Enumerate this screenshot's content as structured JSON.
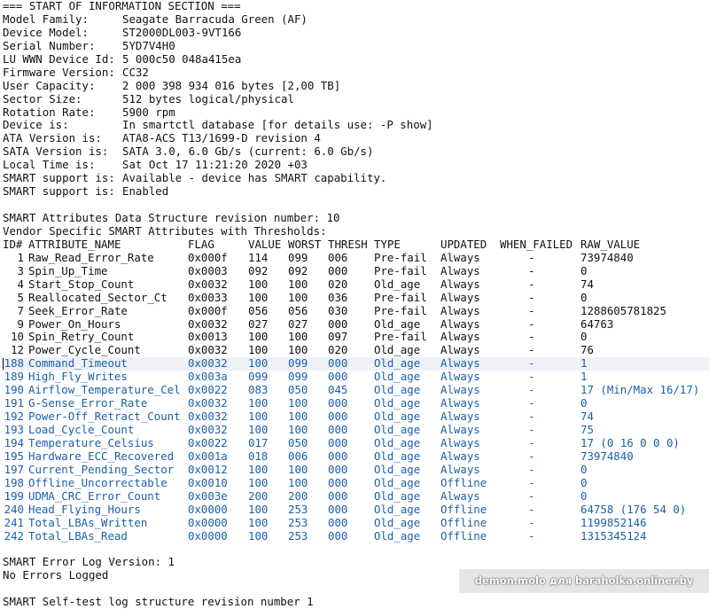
{
  "header_line": "=== START OF INFORMATION SECTION ===",
  "info": [
    {
      "key": "Model Family:",
      "value": "Seagate Barracuda Green (AF)"
    },
    {
      "key": "Device Model:",
      "value": "ST2000DL003-9VT166"
    },
    {
      "key": "Serial Number:",
      "value": "5YD7V4H0"
    },
    {
      "key": "LU WWN Device Id:",
      "value": "5 000c50 048a415ea"
    },
    {
      "key": "Firmware Version:",
      "value": "CC32"
    },
    {
      "key": "User Capacity:",
      "value": "2 000 398 934 016 bytes [2,00 TB]"
    },
    {
      "key": "Sector Size:",
      "value": "512 bytes logical/physical"
    },
    {
      "key": "Rotation Rate:",
      "value": "5900 rpm"
    },
    {
      "key": "Device is:",
      "value": "In smartctl database [for details use: -P show]"
    },
    {
      "key": "ATA Version is:",
      "value": "ATA8-ACS T13/1699-D revision 4"
    },
    {
      "key": "SATA Version is:",
      "value": "SATA 3.0, 6.0 Gb/s (current: 6.0 Gb/s)"
    },
    {
      "key": "Local Time is:",
      "value": "Sat Oct 17 11:21:20 2020 +03"
    },
    {
      "key": "SMART support is:",
      "value": "Available - device has SMART capability."
    },
    {
      "key": "SMART support is:",
      "value": "Enabled"
    }
  ],
  "revision_line": "SMART Attributes Data Structure revision number: 10",
  "vendor_line": "Vendor Specific SMART Attributes with Thresholds:",
  "columns": [
    "ID#",
    "ATTRIBUTE_NAME",
    "FLAG",
    "VALUE",
    "WORST",
    "THRESH",
    "TYPE",
    "UPDATED",
    "WHEN_FAILED",
    "RAW_VALUE"
  ],
  "attributes": [
    {
      "id": "1",
      "name": "Raw_Read_Error_Rate",
      "flag": "0x000f",
      "value": "114",
      "worst": "099",
      "thresh": "006",
      "type": "Pre-fail",
      "updated": "Always",
      "when_failed": "-",
      "raw": "73974840",
      "blue": false
    },
    {
      "id": "3",
      "name": "Spin_Up_Time",
      "flag": "0x0003",
      "value": "092",
      "worst": "092",
      "thresh": "000",
      "type": "Pre-fail",
      "updated": "Always",
      "when_failed": "-",
      "raw": "0",
      "blue": false
    },
    {
      "id": "4",
      "name": "Start_Stop_Count",
      "flag": "0x0032",
      "value": "100",
      "worst": "100",
      "thresh": "020",
      "type": "Old_age",
      "updated": "Always",
      "when_failed": "-",
      "raw": "74",
      "blue": false
    },
    {
      "id": "5",
      "name": "Reallocated_Sector_Ct",
      "flag": "0x0033",
      "value": "100",
      "worst": "100",
      "thresh": "036",
      "type": "Pre-fail",
      "updated": "Always",
      "when_failed": "-",
      "raw": "0",
      "blue": false
    },
    {
      "id": "7",
      "name": "Seek_Error_Rate",
      "flag": "0x000f",
      "value": "056",
      "worst": "056",
      "thresh": "030",
      "type": "Pre-fail",
      "updated": "Always",
      "when_failed": "-",
      "raw": "1288605781825",
      "blue": false
    },
    {
      "id": "9",
      "name": "Power_On_Hours",
      "flag": "0x0032",
      "value": "027",
      "worst": "027",
      "thresh": "000",
      "type": "Old_age",
      "updated": "Always",
      "when_failed": "-",
      "raw": "64763",
      "blue": false
    },
    {
      "id": "10",
      "name": "Spin_Retry_Count",
      "flag": "0x0013",
      "value": "100",
      "worst": "100",
      "thresh": "097",
      "type": "Pre-fail",
      "updated": "Always",
      "when_failed": "-",
      "raw": "0",
      "blue": false
    },
    {
      "id": "12",
      "name": "Power_Cycle_Count",
      "flag": "0x0032",
      "value": "100",
      "worst": "100",
      "thresh": "020",
      "type": "Old_age",
      "updated": "Always",
      "when_failed": "-",
      "raw": "76",
      "blue": false
    },
    {
      "id": "188",
      "name": "Command_Timeout",
      "flag": "0x0032",
      "value": "100",
      "worst": "099",
      "thresh": "000",
      "type": "Old_age",
      "updated": "Always",
      "when_failed": "-",
      "raw": "1",
      "blue": true,
      "selected": true
    },
    {
      "id": "189",
      "name": "High_Fly_Writes",
      "flag": "0x003a",
      "value": "099",
      "worst": "099",
      "thresh": "000",
      "type": "Old_age",
      "updated": "Always",
      "when_failed": "-",
      "raw": "1",
      "blue": true
    },
    {
      "id": "190",
      "name": "Airflow_Temperature_Cel",
      "flag": "0x0022",
      "value": "083",
      "worst": "050",
      "thresh": "045",
      "type": "Old_age",
      "updated": "Always",
      "when_failed": "-",
      "raw": "17 (Min/Max 16/17)",
      "blue": true
    },
    {
      "id": "191",
      "name": "G-Sense_Error_Rate",
      "flag": "0x0032",
      "value": "100",
      "worst": "100",
      "thresh": "000",
      "type": "Old_age",
      "updated": "Always",
      "when_failed": "-",
      "raw": "0",
      "blue": true
    },
    {
      "id": "192",
      "name": "Power-Off_Retract_Count",
      "flag": "0x0032",
      "value": "100",
      "worst": "100",
      "thresh": "000",
      "type": "Old_age",
      "updated": "Always",
      "when_failed": "-",
      "raw": "74",
      "blue": true
    },
    {
      "id": "193",
      "name": "Load_Cycle_Count",
      "flag": "0x0032",
      "value": "100",
      "worst": "100",
      "thresh": "000",
      "type": "Old_age",
      "updated": "Always",
      "when_failed": "-",
      "raw": "75",
      "blue": true
    },
    {
      "id": "194",
      "name": "Temperature_Celsius",
      "flag": "0x0022",
      "value": "017",
      "worst": "050",
      "thresh": "000",
      "type": "Old_age",
      "updated": "Always",
      "when_failed": "-",
      "raw": "17 (0 16 0 0 0)",
      "blue": true
    },
    {
      "id": "195",
      "name": "Hardware_ECC_Recovered",
      "flag": "0x001a",
      "value": "018",
      "worst": "006",
      "thresh": "000",
      "type": "Old_age",
      "updated": "Always",
      "when_failed": "-",
      "raw": "73974840",
      "blue": true
    },
    {
      "id": "197",
      "name": "Current_Pending_Sector",
      "flag": "0x0012",
      "value": "100",
      "worst": "100",
      "thresh": "000",
      "type": "Old_age",
      "updated": "Always",
      "when_failed": "-",
      "raw": "0",
      "blue": true
    },
    {
      "id": "198",
      "name": "Offline_Uncorrectable",
      "flag": "0x0010",
      "value": "100",
      "worst": "100",
      "thresh": "000",
      "type": "Old_age",
      "updated": "Offline",
      "when_failed": "-",
      "raw": "0",
      "blue": true
    },
    {
      "id": "199",
      "name": "UDMA_CRC_Error_Count",
      "flag": "0x003e",
      "value": "200",
      "worst": "200",
      "thresh": "000",
      "type": "Old_age",
      "updated": "Always",
      "when_failed": "-",
      "raw": "0",
      "blue": true
    },
    {
      "id": "240",
      "name": "Head_Flying_Hours",
      "flag": "0x0000",
      "value": "100",
      "worst": "253",
      "thresh": "000",
      "type": "Old_age",
      "updated": "Offline",
      "when_failed": "-",
      "raw": "64758 (176 54 0)",
      "blue": true
    },
    {
      "id": "241",
      "name": "Total_LBAs_Written",
      "flag": "0x0000",
      "value": "100",
      "worst": "253",
      "thresh": "000",
      "type": "Old_age",
      "updated": "Offline",
      "when_failed": "-",
      "raw": "1199852146",
      "blue": true
    },
    {
      "id": "242",
      "name": "Total_LBAs_Read",
      "flag": "0x0000",
      "value": "100",
      "worst": "253",
      "thresh": "000",
      "type": "Old_age",
      "updated": "Offline",
      "when_failed": "-",
      "raw": "1315345124",
      "blue": true
    }
  ],
  "error_log_version": "SMART Error Log Version: 1",
  "no_errors": "No Errors Logged",
  "selftest_line": "SMART Self-test log structure revision number 1",
  "watermark": "demon.molo для baraholka.onliner.by",
  "colors": {
    "text": "#111111",
    "highlight": "#1b5fa8",
    "selected_bg": "#eef2f7"
  }
}
